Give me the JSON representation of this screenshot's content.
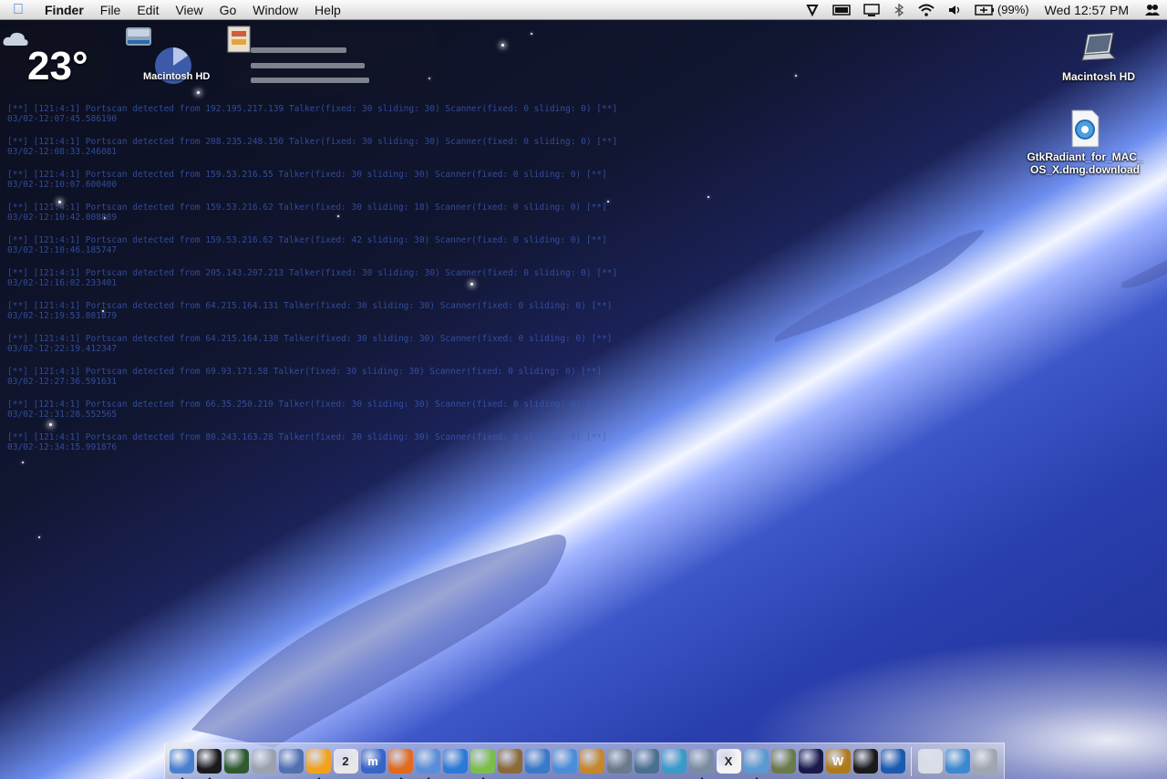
{
  "menubar": {
    "app_name": "Finder",
    "menus": [
      "File",
      "Edit",
      "View",
      "Go",
      "Window",
      "Help"
    ],
    "battery_text": "(99%)",
    "clock": "Wed 12:57 PM"
  },
  "widgets": {
    "weather_temp": "23°",
    "disk_label": "Macintosh HD"
  },
  "desktop_icons": {
    "hd_label": "Macintosh HD",
    "download_label_line1": "GtkRadiant_for_MAC_",
    "download_label_line2": "OS_X.dmg.download"
  },
  "log": [
    {
      "line1": "[**] [121:4:1] Portscan detected from 192.195.217.139 Talker(fixed: 30 sliding: 30) Scanner(fixed: 0 sliding: 0) [**]",
      "line2": "03/02-12:07:45.586190"
    },
    {
      "line1": "[**] [121:4:1] Portscan detected from 208.235.248.150 Talker(fixed: 30 sliding: 30) Scanner(fixed: 0 sliding: 0) [**]",
      "line2": "03/02-12:08:33.246081"
    },
    {
      "line1": "[**] [121:4:1] Portscan detected from 159.53.216.55 Talker(fixed: 30 sliding: 30) Scanner(fixed: 0 sliding: 0) [**]",
      "line2": "03/02-12:10:07.600400"
    },
    {
      "line1": "[**] [121:4:1] Portscan detected from 159.53.216.62 Talker(fixed: 30 sliding: 18) Scanner(fixed: 0 sliding: 0) [**]",
      "line2": "03/02-12:10:42.808889"
    },
    {
      "line1": "[**] [121:4:1] Portscan detected from 159.53.216.62 Talker(fixed: 42 sliding: 30) Scanner(fixed: 0 sliding: 0) [**]",
      "line2": "03/02-12:10:46.185747"
    },
    {
      "line1": "[**] [121:4:1] Portscan detected from 205.143.207.213 Talker(fixed: 30 sliding: 30) Scanner(fixed: 0 sliding: 0) [**]",
      "line2": "03/02-12:16:02.233401"
    },
    {
      "line1": "[**] [121:4:1] Portscan detected from 64.215.164.131 Talker(fixed: 30 sliding: 30) Scanner(fixed: 0 sliding: 0) [**]",
      "line2": "03/02-12:19:53.081879"
    },
    {
      "line1": "[**] [121:4:1] Portscan detected from 64.215.164.138 Talker(fixed: 30 sliding: 30) Scanner(fixed: 0 sliding: 0) [**]",
      "line2": "03/02-12:22:19.412347"
    },
    {
      "line1": "[**] [121:4:1] Portscan detected from 69.93.171.58 Talker(fixed: 30 sliding: 30) Scanner(fixed: 0 sliding: 0) [**]",
      "line2": "03/02-12:27:36.591631"
    },
    {
      "line1": "[**] [121:4:1] Portscan detected from 66.35.250.210 Talker(fixed: 30 sliding: 30) Scanner(fixed: 0 sliding: 0) [**]",
      "line2": "03/02-12:31:28.552565"
    },
    {
      "line1": "[**] [121:4:1] Portscan detected from 80.243.163.28 Talker(fixed: 30 sliding: 30) Scanner(fixed: 0 sliding: 0) [**]",
      "line2": "03/02-12:34:15.991876"
    }
  ],
  "dock": {
    "items": [
      {
        "name": "finder-icon",
        "glyph": "",
        "color": "#4a7fd0",
        "running": true
      },
      {
        "name": "terminal-icon",
        "glyph": "",
        "color": "#1a1a1a",
        "running": true
      },
      {
        "name": "globe-network-icon",
        "glyph": "",
        "color": "#2e5a2e",
        "running": false
      },
      {
        "name": "system-preferences-icon",
        "glyph": "",
        "color": "#9aa2ae",
        "running": false
      },
      {
        "name": "mail-stamp-icon",
        "glyph": "",
        "color": "#5170b0",
        "running": false
      },
      {
        "name": "adium-icon",
        "glyph": "",
        "color": "#f2a21b",
        "running": true
      },
      {
        "name": "ical-icon",
        "glyph": "2",
        "color": "#e8e8e8",
        "running": false
      },
      {
        "name": "m-app-icon",
        "glyph": "m",
        "color": "#3565c7",
        "running": false
      },
      {
        "name": "firefox-icon",
        "glyph": "",
        "color": "#e26a1c",
        "running": true
      },
      {
        "name": "safari-icon",
        "glyph": "",
        "color": "#5a8ed8",
        "running": true
      },
      {
        "name": "quicktime-icon",
        "glyph": "",
        "color": "#2b7ad6",
        "running": false
      },
      {
        "name": "itunes-icon",
        "glyph": "",
        "color": "#7bbf4a",
        "running": true
      },
      {
        "name": "iphoto-icon",
        "glyph": "",
        "color": "#8a6a3a",
        "running": false
      },
      {
        "name": "imovie-icon",
        "glyph": "",
        "color": "#3a78c8",
        "running": false
      },
      {
        "name": "idvd-icon",
        "glyph": "",
        "color": "#4a8ed8",
        "running": false
      },
      {
        "name": "garageband-icon",
        "glyph": "",
        "color": "#c5872b",
        "running": false
      },
      {
        "name": "iweb-icon",
        "glyph": "",
        "color": "#6a7a8a",
        "running": false
      },
      {
        "name": "preview-icon",
        "glyph": "",
        "color": "#4a7090",
        "running": false
      },
      {
        "name": "dashcode-icon",
        "glyph": "",
        "color": "#3a9ac8",
        "running": false
      },
      {
        "name": "xcode-icon",
        "glyph": "",
        "color": "#7a8ca0",
        "running": true
      },
      {
        "name": "x11-icon",
        "glyph": "X",
        "color": "#f4f4f4",
        "running": false
      },
      {
        "name": "remote-desktop-icon",
        "glyph": "",
        "color": "#5a9ad0",
        "running": true
      },
      {
        "name": "game-icon",
        "glyph": "",
        "color": "#6a7a4a",
        "running": false
      },
      {
        "name": "unreal-icon",
        "glyph": "",
        "color": "#1a1a4a",
        "running": false
      },
      {
        "name": "warcraft-icon",
        "glyph": "W",
        "color": "#b07a1a",
        "running": false
      },
      {
        "name": "rs-app-icon",
        "glyph": "",
        "color": "#1a1a1a",
        "running": false
      },
      {
        "name": "g-app-icon",
        "glyph": "",
        "color": "#1a5ab0",
        "running": false
      }
    ],
    "right_items": [
      {
        "name": "cloud-folder-icon",
        "glyph": "",
        "color": "#d8dde6"
      },
      {
        "name": "globe-icon",
        "glyph": "",
        "color": "#3a8ad0"
      },
      {
        "name": "trash-icon",
        "glyph": "",
        "color": "#a0a6b0"
      }
    ]
  }
}
